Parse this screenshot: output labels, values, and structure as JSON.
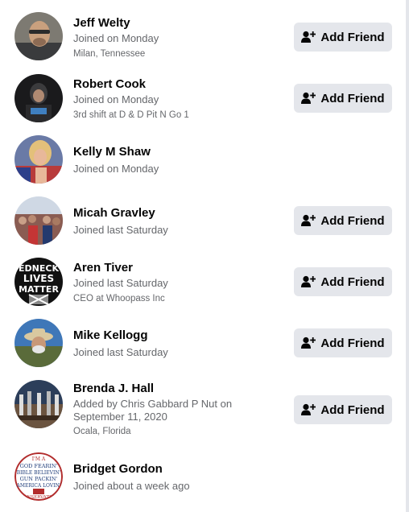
{
  "add_friend_label": "Add Friend",
  "people": [
    {
      "name": "Jeff Welty",
      "status": "Joined on Monday",
      "subtitle": "Milan, Tennessee"
    },
    {
      "name": "Robert Cook",
      "status": "Joined on Monday",
      "subtitle": "3rd shift at D & D Pit N Go 1"
    },
    {
      "name": "Kelly M Shaw",
      "status": "Joined on Monday",
      "subtitle": ""
    },
    {
      "name": "Micah Gravley",
      "status": "Joined last Saturday",
      "subtitle": ""
    },
    {
      "name": "Aren Tiver",
      "status": "Joined last Saturday",
      "subtitle": "CEO at Whoopass Inc"
    },
    {
      "name": "Mike Kellogg",
      "status": "Joined last Saturday",
      "subtitle": ""
    },
    {
      "name": "Brenda J. Hall",
      "status_line1": "Added by Chris Gabbard P Nut on",
      "status_line2": "September 11, 2020",
      "subtitle": "Ocala, Florida"
    },
    {
      "name": "Bridget Gordon",
      "status": "Joined about a week ago",
      "subtitle": ""
    }
  ],
  "avatar_text": {
    "aren": [
      "EDNECK",
      "LIVES",
      "MATTER"
    ],
    "bridget": [
      "I'M A",
      "GOD FEARIN'",
      "BIBLE BELIEVIN'",
      "GUN PACKIN'",
      "AMERICA LOVIN'",
      "CONSERVATIVE"
    ]
  }
}
